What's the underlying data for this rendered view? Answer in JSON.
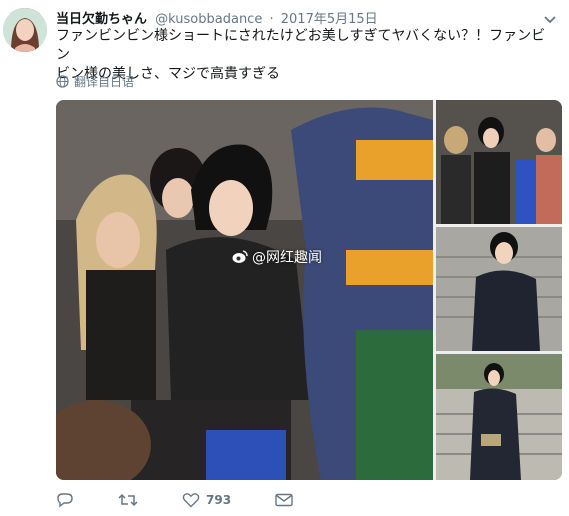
{
  "tweet": {
    "display_name": "当日欠勤ちゃん",
    "handle": "@kusobbadance",
    "separator": "·",
    "timestamp": "2017年5月15日",
    "text_line_1": "ファンビンビン様ショートにされたけどお美しすぎてヤバくない？！ファンビン",
    "text_line_2": "ビン様の美しさ、マジで高貴すぎる",
    "translate_label": "翻译自日语",
    "watermark_text": "@网红趣闻",
    "like_count": "793"
  },
  "icons": {
    "translate": "globe-icon",
    "caret": "chevron-down-icon",
    "reply": "reply-icon",
    "retweet": "retweet-icon",
    "like": "heart-icon",
    "dm": "mail-icon",
    "watermark": "weibo-logo-icon"
  },
  "colors": {
    "secondary_text": "#657786",
    "primary_text": "#14171a",
    "background": "#ffffff"
  }
}
